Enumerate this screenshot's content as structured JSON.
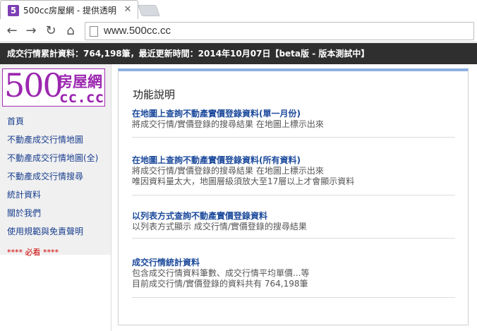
{
  "browser": {
    "tab_title": "500cc房屋網 - 提供透明",
    "favicon_letter": "5",
    "url": "www.500cc.cc"
  },
  "banner": {
    "text": "成交行情累計資料：764,198筆，最近更新時間：2014年10月07日【beta版 - 版本測試中】"
  },
  "logo": {
    "big": "500",
    "house": "房屋網",
    "cc": "cc.cc",
    "color": "#9c27b0"
  },
  "sidebar": {
    "items": [
      {
        "label": "首頁"
      },
      {
        "label": "不動產成交行情地圖"
      },
      {
        "label": "不動產成交行情地圖(全)"
      },
      {
        "label": "不動產成交行情搜尋"
      },
      {
        "label": "統計資料"
      },
      {
        "label": "關於我們"
      },
      {
        "label": "使用規範與免責聲明"
      }
    ],
    "must_read": "**** 必看 ****"
  },
  "main": {
    "title": "功能說明",
    "features": [
      {
        "link": "在地圖上查詢不動產實價登錄資料(單一月份)",
        "desc": [
          "將成交行情/實價登錄的搜尋結果 在地圖上標示出來"
        ]
      },
      {
        "link": "在地圖上查詢不動產實價登錄資料(所有資料)",
        "desc": [
          "將成交行情/實價登錄的搜尋結果 在地圖上標示出來",
          "唯因資料量太大，地圖層級須放大至17層以上才會顯示資料"
        ]
      },
      {
        "link": "以列表方式查詢不動產實價登錄資料",
        "desc": [
          "以列表方式顯示 成交行情/實價登錄的搜尋結果"
        ]
      },
      {
        "link": "成交行情統計資料",
        "desc": [
          "包含成交行情資料筆數、成交行情平均單價...等",
          "目前成交行情/實價登錄的資料共有 764,198筆"
        ]
      }
    ]
  },
  "colors": {
    "link": "#1c4a9c",
    "banner_bg": "#2f2f2f",
    "panel_accent": "#8ab0e0"
  }
}
